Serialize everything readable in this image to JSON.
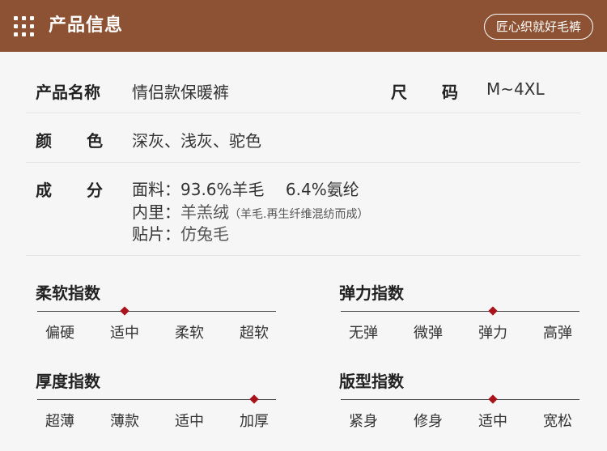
{
  "header": {
    "title": "产品信息",
    "badge": "匠心织就好毛裤",
    "icon": "grid-icon"
  },
  "info": {
    "name_label": "产品名称",
    "name_value": "情侣款保暖裤",
    "size_label": "尺码",
    "size_value": "M~4XL",
    "color_label": "颜色",
    "color_value": "深灰、浅灰、驼色",
    "comp_label": "成分",
    "fabric_label": "面料：",
    "fabric_value": "93.6%羊毛　 6.4%氨纶",
    "lining_label": "内里：",
    "lining_value": "羊羔绒",
    "lining_note": "（羊毛.再生纤维混纺而成）",
    "patch_label": "贴片：",
    "patch_value": "仿兔毛"
  },
  "scales": {
    "softness": {
      "title": "柔软指数",
      "options": [
        "偏硬",
        "适中",
        "柔软",
        "超软"
      ],
      "selected_index": 1
    },
    "elasticity": {
      "title": "弹力指数",
      "options": [
        "无弹",
        "微弹",
        "弹力",
        "高弹"
      ],
      "selected_index": 2
    },
    "thickness": {
      "title": "厚度指数",
      "options": [
        "超薄",
        "薄款",
        "适中",
        "加厚"
      ],
      "selected_index": 3
    },
    "fit": {
      "title": "版型指数",
      "options": [
        "紧身",
        "修身",
        "适中",
        "宽松"
      ],
      "selected_index": 2
    }
  },
  "colors": {
    "header_bg": "#8d5233",
    "marker": "#a8131c"
  }
}
